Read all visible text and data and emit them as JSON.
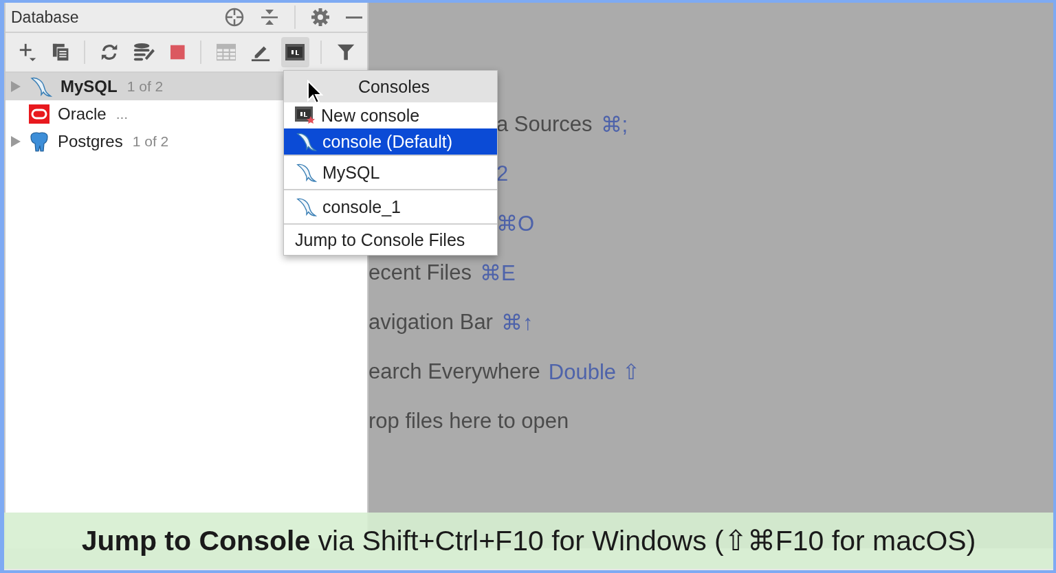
{
  "panel": {
    "title": "Database"
  },
  "tree": [
    {
      "name": "MySQL",
      "detail": "1 of 2",
      "kind": "mysql",
      "expandable": true,
      "selected": true
    },
    {
      "name": "Oracle",
      "detail": "...",
      "kind": "oracle",
      "expandable": false,
      "selected": false
    },
    {
      "name": "Postgres",
      "detail": "1 of 2",
      "kind": "postgres",
      "expandable": true,
      "selected": false
    }
  ],
  "popup": {
    "title": "Consoles",
    "items": [
      {
        "label": "New console",
        "kind": "new",
        "selected": false
      },
      {
        "label": "console (Default)",
        "kind": "console",
        "selected": true
      },
      {
        "label": "MySQL",
        "kind": "console",
        "selected": false
      },
      {
        "label": "console_1",
        "kind": "console",
        "selected": false
      }
    ],
    "footer": "Jump to Console Files"
  },
  "hints": [
    {
      "text": "a Sources",
      "shortcut": "⌘;",
      "covered": true
    },
    {
      "shortcut": "2",
      "covered": true
    },
    {
      "shortcut": "⌘O",
      "covered": true
    },
    {
      "text": "ecent Files",
      "shortcut": "⌘E",
      "covered": false
    },
    {
      "text": "avigation Bar",
      "shortcut": "⌘↑",
      "covered": false
    },
    {
      "text": "earch Everywhere",
      "shortcut": "Double ⇧",
      "covered": false
    },
    {
      "text": "rop files here to open",
      "covered": false
    }
  ],
  "caption": "**Jump to Console** via Shift+Ctrl+F10 for Windows (⇧⌘F10 for macOS)"
}
